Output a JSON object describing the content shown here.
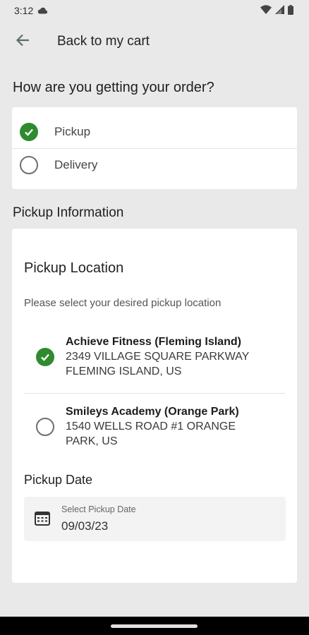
{
  "status_bar": {
    "time": "3:12"
  },
  "app_bar": {
    "back_label": "Back to my cart"
  },
  "order_method": {
    "heading": "How are you getting your order?",
    "options": [
      {
        "label": "Pickup",
        "selected": true
      },
      {
        "label": "Delivery",
        "selected": false
      }
    ]
  },
  "pickup_info": {
    "heading": "Pickup Information",
    "location_title": "Pickup Location",
    "location_subtitle": "Please select your desired pickup location",
    "locations": [
      {
        "name": "Achieve Fitness (Fleming Island)",
        "address_line1": "2349 VILLAGE SQUARE PARKWAY",
        "address_line2": "FLEMING ISLAND, US",
        "selected": true
      },
      {
        "name": "Smileys Academy (Orange Park)",
        "address_line1": "1540 WELLS ROAD #1 ORANGE",
        "address_line2": "PARK, US",
        "selected": false
      }
    ],
    "date_label": "Pickup Date",
    "date_field": {
      "caption": "Select Pickup Date",
      "value": "09/03/23"
    }
  },
  "colors": {
    "accent": "#2e8b2e",
    "background": "#e9e9e9",
    "card": "#ffffff"
  },
  "icons": {
    "back": "arrow-left-icon",
    "calendar": "calendar-icon",
    "check": "check-circle-icon",
    "wifi": "wifi-icon",
    "signal": "signal-icon",
    "battery": "battery-icon",
    "cloud": "cloud-icon"
  }
}
